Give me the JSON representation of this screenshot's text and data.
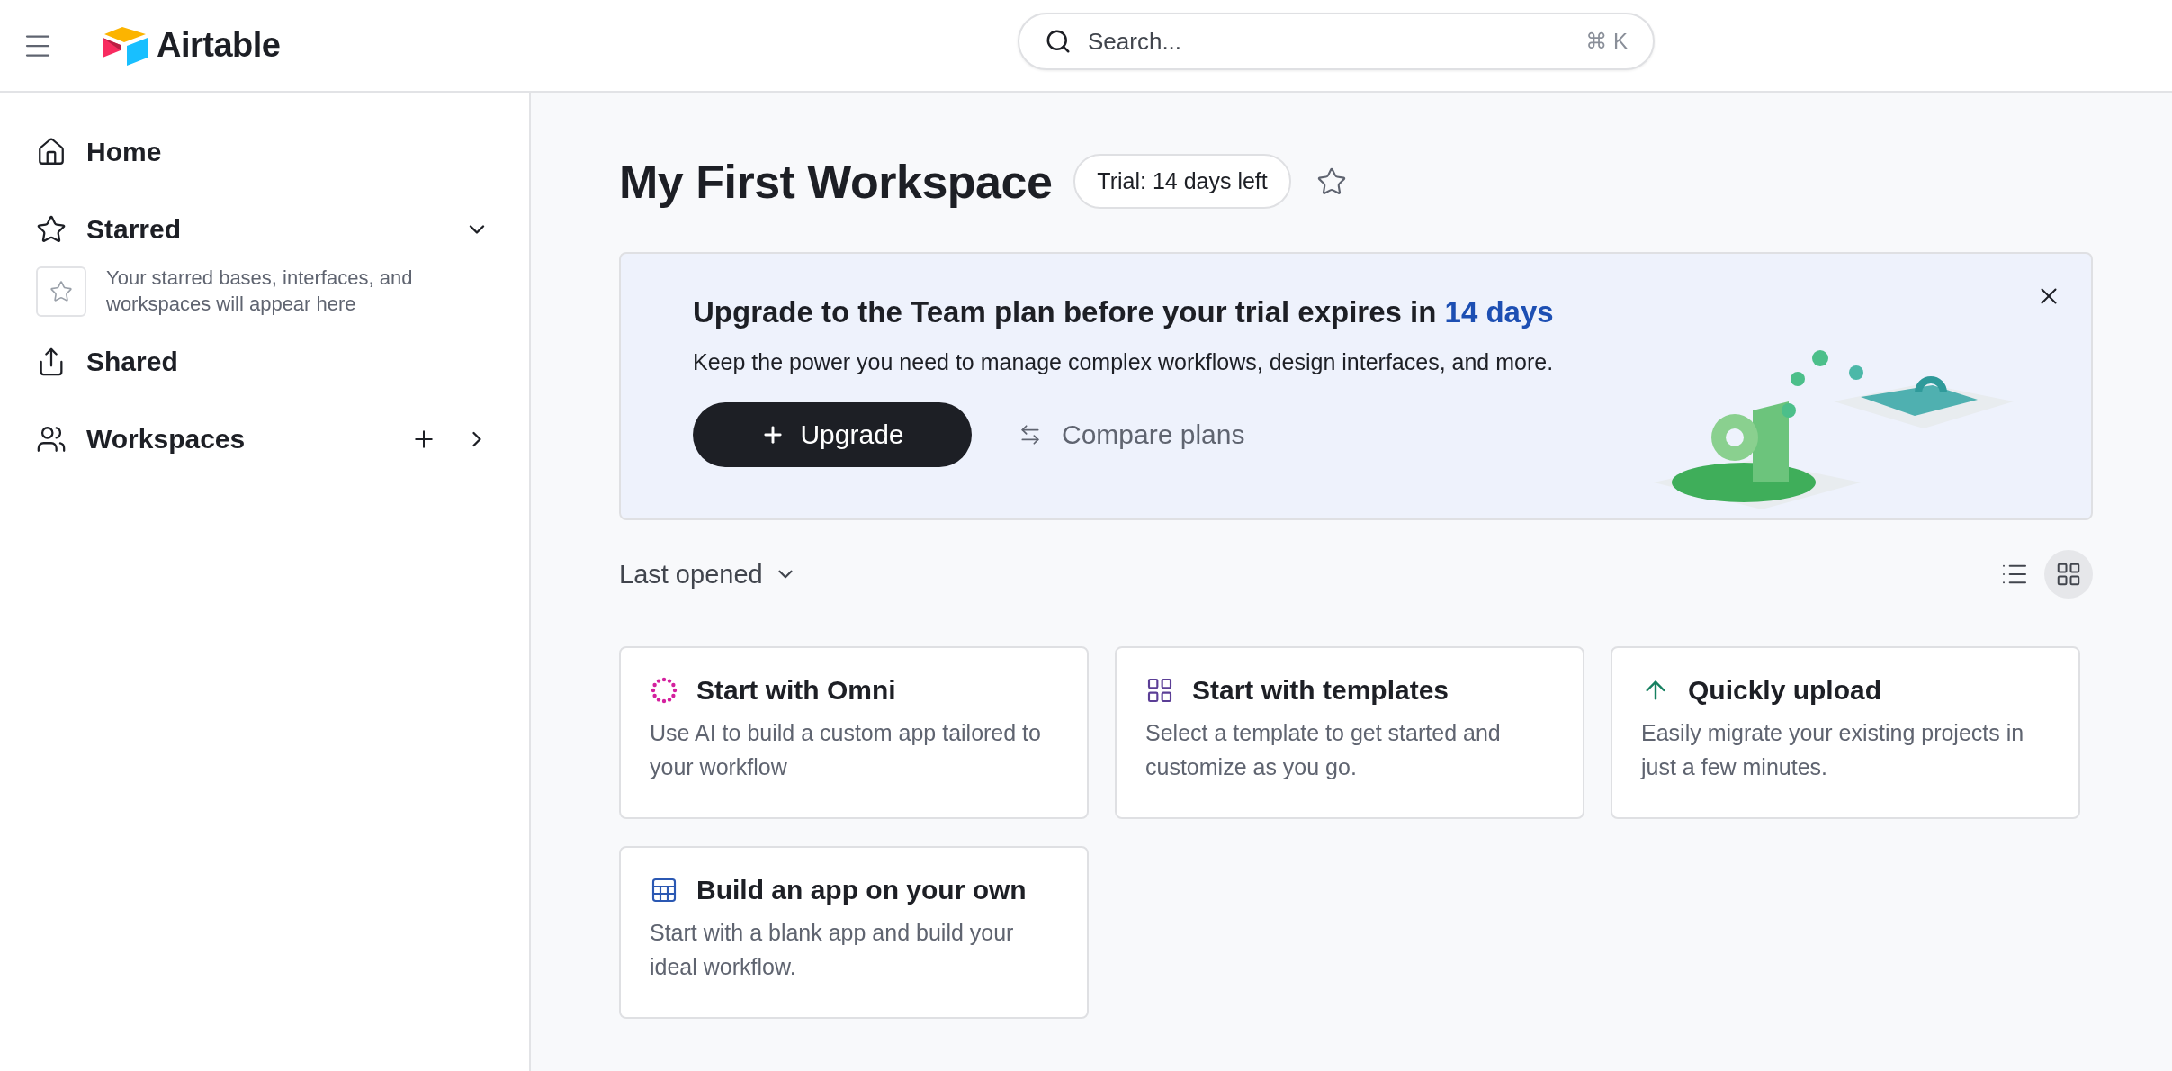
{
  "header": {
    "logo_text": "Airtable",
    "search": {
      "placeholder": "Search...",
      "shortcut": "⌘ K"
    }
  },
  "sidebar": {
    "items": [
      {
        "kind": "home",
        "label": "Home"
      },
      {
        "kind": "starred",
        "label": "Starred",
        "expanded": true,
        "hint": "Your starred bases, interfaces, and workspaces will appear here"
      },
      {
        "kind": "shared",
        "label": "Shared"
      },
      {
        "kind": "workspaces",
        "label": "Workspaces"
      }
    ]
  },
  "workspace": {
    "title": "My First Workspace",
    "trial_badge": "Trial: 14 days left",
    "starred": false
  },
  "banner": {
    "title": "Upgrade to the Team plan before your trial expires in ",
    "title_highlight": "14 days",
    "text": "Keep the power you need to manage complex workflows, design interfaces, and more.",
    "primary_button": "Upgrade",
    "secondary_button": "Compare plans"
  },
  "sort": {
    "label": "Last opened"
  },
  "view_toggle": [
    {
      "kind": "list",
      "selected": false
    },
    {
      "kind": "grid",
      "selected": true
    }
  ],
  "cards": [
    {
      "kind": "omni",
      "title": "Start with Omni",
      "description": "Use AI to build a custom app tailored to your workflow"
    },
    {
      "kind": "templates",
      "title": "Start with templates",
      "description": "Select a template to get started and customize as you go."
    },
    {
      "kind": "upload",
      "title": "Quickly upload",
      "description": "Easily migrate your existing projects in just a few minutes."
    },
    {
      "kind": "blank",
      "title": "Build an app on your own",
      "description": "Start with a blank app and build your ideal workflow."
    }
  ]
}
